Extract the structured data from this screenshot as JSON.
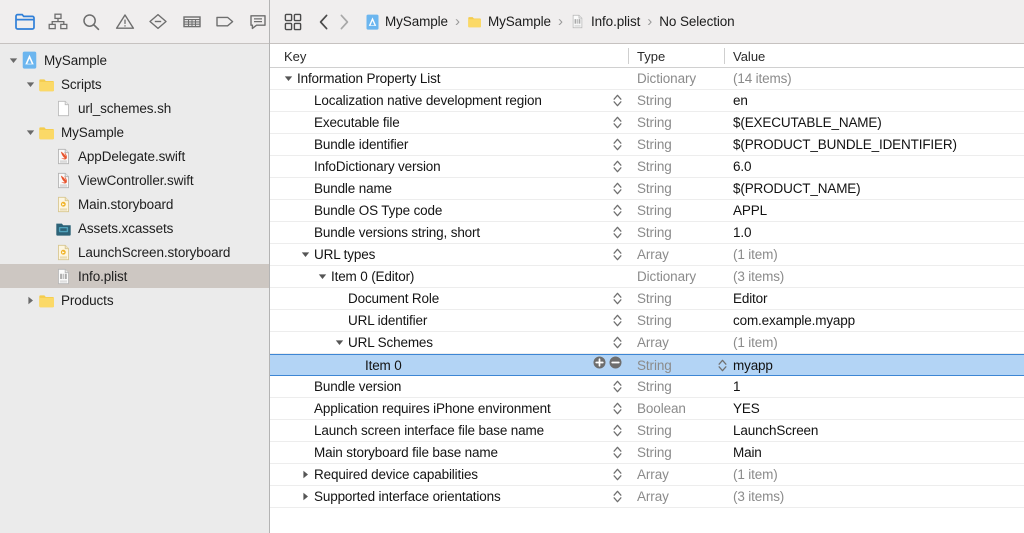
{
  "navigator": {
    "tabs": [
      {
        "name": "project-navigator-tab",
        "icon": "folder-icon",
        "active": true
      },
      {
        "name": "source-control-navigator-tab",
        "icon": "hierarchy-icon",
        "active": false
      },
      {
        "name": "find-navigator-tab",
        "icon": "search-icon",
        "active": false
      },
      {
        "name": "issue-navigator-tab",
        "icon": "warning-triangle-icon",
        "active": false
      },
      {
        "name": "test-navigator-tab",
        "icon": "diamond-minus-icon",
        "active": false
      },
      {
        "name": "debug-navigator-tab",
        "icon": "debug-grid-icon",
        "active": false
      },
      {
        "name": "breakpoint-navigator-tab",
        "icon": "tag-icon",
        "active": false
      },
      {
        "name": "report-navigator-tab",
        "icon": "speech-bubble-icon",
        "active": false
      }
    ],
    "tree": [
      {
        "label": "MySample",
        "depth": 0,
        "icon": "xcode-project-icon",
        "twisty": "down",
        "selected": false
      },
      {
        "label": "Scripts",
        "depth": 1,
        "icon": "folder-yellow-icon",
        "twisty": "down",
        "selected": false
      },
      {
        "label": "url_schemes.sh",
        "depth": 2,
        "icon": "blank-file-icon",
        "twisty": "none",
        "selected": false
      },
      {
        "label": "MySample",
        "depth": 1,
        "icon": "folder-yellow-icon",
        "twisty": "down",
        "selected": false
      },
      {
        "label": "AppDelegate.swift",
        "depth": 2,
        "icon": "swift-file-icon",
        "twisty": "none",
        "selected": false
      },
      {
        "label": "ViewController.swift",
        "depth": 2,
        "icon": "swift-file-icon",
        "twisty": "none",
        "selected": false
      },
      {
        "label": "Main.storyboard",
        "depth": 2,
        "icon": "storyboard-file-icon",
        "twisty": "none",
        "selected": false
      },
      {
        "label": "Assets.xcassets",
        "depth": 2,
        "icon": "xcassets-icon",
        "twisty": "none",
        "selected": false
      },
      {
        "label": "LaunchScreen.storyboard",
        "depth": 2,
        "icon": "storyboard-file-icon",
        "twisty": "none",
        "selected": false
      },
      {
        "label": "Info.plist",
        "depth": 2,
        "icon": "plist-file-icon",
        "twisty": "none",
        "selected": true
      },
      {
        "label": "Products",
        "depth": 1,
        "icon": "folder-yellow-icon",
        "twisty": "right",
        "selected": false
      }
    ]
  },
  "jumpbar": {
    "related_items_icon": "related-items-icon",
    "back_icon": "chevron-left-icon",
    "forward_icon": "chevron-right-icon",
    "separator": "›",
    "breadcrumbs": [
      {
        "label": "MySample",
        "icon": "xcode-project-icon"
      },
      {
        "label": "MySample",
        "icon": "folder-yellow-icon"
      },
      {
        "label": "Info.plist",
        "icon": "plist-file-icon"
      },
      {
        "label": "No Selection",
        "icon": "none"
      }
    ]
  },
  "plist": {
    "columns": {
      "key": "Key",
      "type": "Type",
      "value": "Value"
    },
    "rows": [
      {
        "key": "Information Property List",
        "depth": 0,
        "twisty": "down",
        "type": "Dictionary",
        "value": "(14 items)",
        "value_muted": true,
        "stepper": false,
        "selected": false
      },
      {
        "key": "Localization native development region",
        "depth": 1,
        "twisty": "none",
        "type": "String",
        "value": "en",
        "value_muted": false,
        "stepper": true,
        "selected": false
      },
      {
        "key": "Executable file",
        "depth": 1,
        "twisty": "none",
        "type": "String",
        "value": "$(EXECUTABLE_NAME)",
        "value_muted": false,
        "stepper": true,
        "selected": false
      },
      {
        "key": "Bundle identifier",
        "depth": 1,
        "twisty": "none",
        "type": "String",
        "value": "$(PRODUCT_BUNDLE_IDENTIFIER)",
        "value_muted": false,
        "stepper": true,
        "selected": false
      },
      {
        "key": "InfoDictionary version",
        "depth": 1,
        "twisty": "none",
        "type": "String",
        "value": "6.0",
        "value_muted": false,
        "stepper": true,
        "selected": false
      },
      {
        "key": "Bundle name",
        "depth": 1,
        "twisty": "none",
        "type": "String",
        "value": "$(PRODUCT_NAME)",
        "value_muted": false,
        "stepper": true,
        "selected": false
      },
      {
        "key": "Bundle OS Type code",
        "depth": 1,
        "twisty": "none",
        "type": "String",
        "value": "APPL",
        "value_muted": false,
        "stepper": true,
        "selected": false
      },
      {
        "key": "Bundle versions string, short",
        "depth": 1,
        "twisty": "none",
        "type": "String",
        "value": "1.0",
        "value_muted": false,
        "stepper": true,
        "selected": false
      },
      {
        "key": "URL types",
        "depth": 1,
        "twisty": "down",
        "type": "Array",
        "value": "(1 item)",
        "value_muted": true,
        "stepper": true,
        "selected": false
      },
      {
        "key": "Item 0 (Editor)",
        "depth": 2,
        "twisty": "down",
        "type": "Dictionary",
        "value": "(3 items)",
        "value_muted": true,
        "stepper": false,
        "selected": false
      },
      {
        "key": "Document Role",
        "depth": 3,
        "twisty": "none",
        "type": "String",
        "value": "Editor",
        "value_muted": false,
        "stepper": true,
        "selected": false
      },
      {
        "key": "URL identifier",
        "depth": 3,
        "twisty": "none",
        "type": "String",
        "value": "com.example.myapp",
        "value_muted": false,
        "stepper": true,
        "selected": false
      },
      {
        "key": "URL Schemes",
        "depth": 3,
        "twisty": "down",
        "type": "Array",
        "value": "(1 item)",
        "value_muted": true,
        "stepper": true,
        "selected": false
      },
      {
        "key": "Item 0",
        "depth": 4,
        "twisty": "none",
        "type": "String",
        "value": "myapp",
        "value_muted": false,
        "stepper": true,
        "selected": true
      },
      {
        "key": "Bundle version",
        "depth": 1,
        "twisty": "none",
        "type": "String",
        "value": "1",
        "value_muted": false,
        "stepper": true,
        "selected": false
      },
      {
        "key": "Application requires iPhone environment",
        "depth": 1,
        "twisty": "none",
        "type": "Boolean",
        "value": "YES",
        "value_muted": false,
        "stepper": true,
        "selected": false
      },
      {
        "key": "Launch screen interface file base name",
        "depth": 1,
        "twisty": "none",
        "type": "String",
        "value": "LaunchScreen",
        "value_muted": false,
        "stepper": true,
        "selected": false
      },
      {
        "key": "Main storyboard file base name",
        "depth": 1,
        "twisty": "none",
        "type": "String",
        "value": "Main",
        "value_muted": false,
        "stepper": true,
        "selected": false
      },
      {
        "key": "Required device capabilities",
        "depth": 1,
        "twisty": "right",
        "type": "Array",
        "value": "(1 item)",
        "value_muted": true,
        "stepper": true,
        "selected": false
      },
      {
        "key": "Supported interface orientations",
        "depth": 1,
        "twisty": "right",
        "type": "Array",
        "value": "(3 items)",
        "value_muted": true,
        "stepper": true,
        "selected": false
      }
    ],
    "add_button_icon": "plus-circle-icon",
    "remove_button_icon": "minus-circle-icon",
    "stepper_icon": "stepper-updown-icon"
  },
  "colors": {
    "selection_blue_fill": "#b3d4f5",
    "selection_blue_border": "#3d86d4",
    "sidebar_selection": "#cdc7c2",
    "toolbar_bg": "#f0eeee",
    "sidebar_bg": "#ebebeb",
    "accent_blue": "#2f7fd8",
    "folder_yellow": "#f3cb4d",
    "muted_text": "#8b8b8b"
  }
}
